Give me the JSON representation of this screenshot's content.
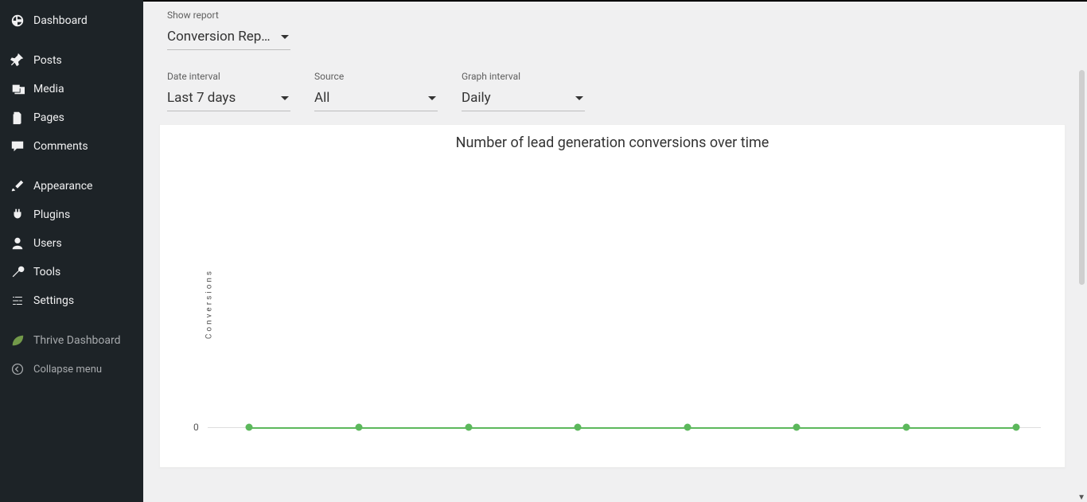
{
  "sidebar": {
    "items": [
      {
        "label": "Dashboard"
      },
      {
        "label": "Posts"
      },
      {
        "label": "Media"
      },
      {
        "label": "Pages"
      },
      {
        "label": "Comments"
      },
      {
        "label": "Appearance"
      },
      {
        "label": "Plugins"
      },
      {
        "label": "Users"
      },
      {
        "label": "Tools"
      },
      {
        "label": "Settings"
      },
      {
        "label": "Thrive Dashboard"
      },
      {
        "label": "Collapse menu"
      }
    ]
  },
  "filters": {
    "show_report_label": "Show report",
    "show_report_value": "Conversion Rep…",
    "date_interval_label": "Date interval",
    "date_interval_value": "Last 7 days",
    "source_label": "Source",
    "source_value": "All",
    "graph_interval_label": "Graph interval",
    "graph_interval_value": "Daily"
  },
  "chart_data": {
    "type": "line",
    "title": "Number of lead generation conversions over time",
    "ylabel": "Conversions",
    "yticks": [
      0
    ],
    "ylim": [
      0,
      1
    ],
    "x_count": 8,
    "series": [
      {
        "name": "Conversions",
        "values": [
          0,
          0,
          0,
          0,
          0,
          0,
          0,
          0
        ],
        "color": "#5cb85c"
      }
    ]
  }
}
